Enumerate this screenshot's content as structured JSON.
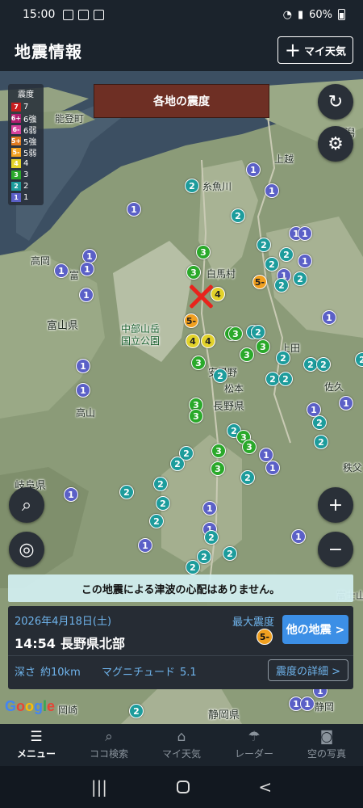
{
  "status_bar": {
    "time": "15:00",
    "battery": "60%"
  },
  "header": {
    "title": "地震情報",
    "my_weather_plus": "+",
    "my_weather_label": "マイ天気"
  },
  "map": {
    "title_banner": "各地の震度",
    "legend": {
      "title": "震度",
      "items": [
        {
          "code": "7",
          "label": "7",
          "color": "#c81e1e"
        },
        {
          "code": "6+",
          "label": "6強",
          "color": "#b01e6e"
        },
        {
          "code": "6-",
          "label": "6弱",
          "color": "#d6429c"
        },
        {
          "code": "5+",
          "label": "5強",
          "color": "#e07a20"
        },
        {
          "code": "5-",
          "label": "5弱",
          "color": "#f0a020"
        },
        {
          "code": "4",
          "label": "4",
          "color": "#e2d22a"
        },
        {
          "code": "3",
          "label": "3",
          "color": "#2aa92a"
        },
        {
          "code": "2",
          "label": "2",
          "color": "#1d9c9c"
        },
        {
          "code": "1",
          "label": "1",
          "color": "#5b60c7"
        }
      ]
    },
    "places": {
      "noto": "能登町",
      "joetsu": "上越",
      "niigata": "新潟",
      "itoigawa": "糸魚川",
      "takaoka": "高岡",
      "toyama_short": "富",
      "toyama": "富山県",
      "chubu1": "中部山岳",
      "chubu2": "国立公園",
      "hakuba": "白馬村",
      "ueda": "上田",
      "azumino": "安曇野",
      "matsumoto": "松本",
      "saku": "佐久",
      "takayama": "高山",
      "nagano": "長野県",
      "gifu": "岐阜県",
      "chichibu": "秩父",
      "fujisan": "富士山",
      "shizuoka": "静岡県",
      "okazaki": "岡崎",
      "iwata": "静岡"
    },
    "tsunami_message": "この地震による津波の心配はありません。",
    "google_label": "Google"
  },
  "info_card": {
    "date": "2026年4月18日(土)",
    "time": "14:54",
    "location": "長野県北部",
    "max_label": "最大震度",
    "max_value": "5-",
    "other_button": "他の地震 >",
    "depth_label": "深さ",
    "depth_value": "約10km",
    "mag_label": "マグニチュード",
    "mag_value": "5.1",
    "detail_button": "震度の詳細 >"
  },
  "bottom_nav": [
    {
      "icon": "menu-icon",
      "glyph": "☰",
      "label": "メニュー",
      "active": true
    },
    {
      "icon": "search-icon",
      "glyph": "⌕",
      "label": "ココ検索",
      "active": false
    },
    {
      "icon": "home-icon",
      "glyph": "⌂",
      "label": "マイ天気",
      "active": false
    },
    {
      "icon": "radar-icon",
      "glyph": "☂",
      "label": "レーダー",
      "active": false
    },
    {
      "icon": "camera-icon",
      "glyph": "◙",
      "label": "空の写真",
      "active": false
    }
  ],
  "android_nav": {
    "recents": "|||",
    "back": "<"
  }
}
